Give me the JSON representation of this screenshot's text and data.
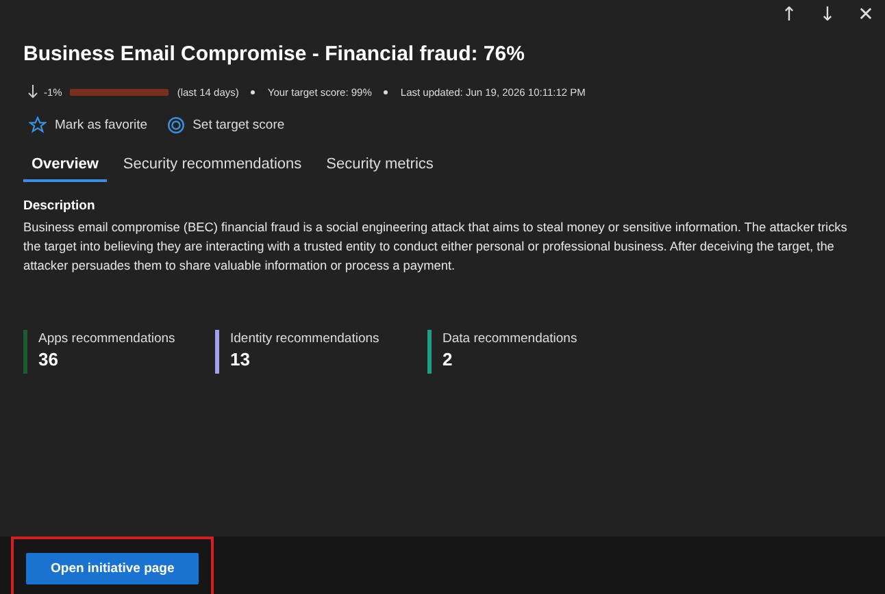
{
  "nav": {
    "up": "↑",
    "down": "↓",
    "close": "✕"
  },
  "title": "Business Email Compromise - Financial fraud: 76%",
  "meta": {
    "change": "-1%",
    "period": "(last 14 days)",
    "target": "Your target score: 99%",
    "updated": "Last updated: Jun 19, 2026 10:11:12 PM"
  },
  "actions": [
    {
      "kind": "favorite",
      "label": "Mark as favorite"
    },
    {
      "kind": "target",
      "label": "Set target score"
    }
  ],
  "tabs": [
    {
      "label": "Overview",
      "selected": true
    },
    {
      "label": "Security recommendations",
      "selected": false
    },
    {
      "label": "Security metrics",
      "selected": false
    }
  ],
  "description": {
    "heading": "Description",
    "text": "Business email compromise (BEC) financial fraud is a social engineering attack that aims to steal money or sensitive information. The attacker tricks the target into believing they are interacting with a trusted entity to conduct either personal or professional business. After deceiving the target, the attacker persuades them to share valuable information or process a payment."
  },
  "stats": [
    {
      "label": "Apps recommendations",
      "value": "36",
      "color": "#1e5a30"
    },
    {
      "label": "Identity recommendations",
      "value": "13",
      "color": "#a89ef0"
    },
    {
      "label": "Data recommendations",
      "value": "2",
      "color": "#1f9e8a"
    }
  ],
  "footer": {
    "button": "Open initiative page",
    "highlighted": true
  }
}
